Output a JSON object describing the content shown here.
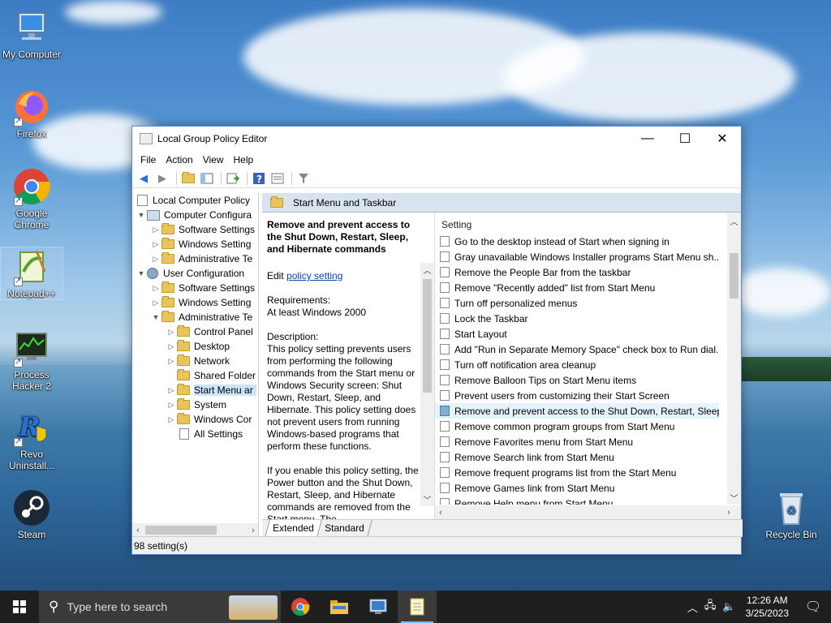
{
  "desktop": {
    "icons": [
      {
        "label": "My Computer"
      },
      {
        "label": "Firefox"
      },
      {
        "label": "Google Chrome"
      },
      {
        "label": "Notepad++"
      },
      {
        "label": "Process Hacker 2"
      },
      {
        "label": "Revo Uninstall..."
      },
      {
        "label": "Steam"
      },
      {
        "label": "Recycle Bin"
      }
    ]
  },
  "window": {
    "title": "Local Group Policy Editor",
    "controls": {
      "minimize": "—",
      "maximize": "☐",
      "close": "✕"
    },
    "menu": [
      "File",
      "Action",
      "View",
      "Help"
    ],
    "tree": [
      {
        "label": "Local Computer Policy"
      },
      {
        "label": "Computer Configura"
      },
      {
        "label": "Software Settings"
      },
      {
        "label": "Windows Setting"
      },
      {
        "label": "Administrative Te"
      },
      {
        "label": "User Configuration"
      },
      {
        "label": "Software Settings"
      },
      {
        "label": "Windows Setting"
      },
      {
        "label": "Administrative Te"
      },
      {
        "label": "Control Panel"
      },
      {
        "label": "Desktop"
      },
      {
        "label": "Network"
      },
      {
        "label": "Shared Folder"
      },
      {
        "label": "Start Menu ar"
      },
      {
        "label": "System"
      },
      {
        "label": "Windows Cor"
      },
      {
        "label": "All Settings"
      }
    ],
    "category": "Start Menu and Taskbar",
    "extended": {
      "title": "Remove and prevent access to the Shut Down, Restart, Sleep, and Hibernate commands",
      "edit_prefix": "Edit ",
      "edit_link": "policy setting",
      "requirements_label": "Requirements:",
      "requirements_value": "At least Windows 2000",
      "description_label": "Description:",
      "description": "This policy setting prevents users from performing the following commands from the Start menu or Windows Security screen: Shut Down, Restart, Sleep, and Hibernate. This policy setting does not prevent users from running Windows-based programs that perform these functions.",
      "paragraph2": "If you enable this policy setting, the Power button and the Shut Down, Restart, Sleep, and Hibernate commands are removed from the Start menu. The"
    },
    "list_header": "Setting",
    "settings": [
      "Go to the desktop instead of Start when signing in",
      "Gray unavailable Windows Installer programs Start Menu sh...",
      "Remove the People Bar from the taskbar",
      "Remove \"Recently added\" list from Start Menu",
      "Turn off personalized menus",
      "Lock the Taskbar",
      "Start Layout",
      "Add \"Run in Separate Memory Space\" check box to Run dial...",
      "Turn off notification area cleanup",
      "Remove Balloon Tips on Start Menu items",
      "Prevent users from customizing their Start Screen",
      "Remove and prevent access to the Shut Down, Restart, Sleep...",
      "Remove common program groups from Start Menu",
      "Remove Favorites menu from Start Menu",
      "Remove Search link from Start Menu",
      "Remove frequent programs list from the Start Menu",
      "Remove Games link from Start Menu",
      "Remove Help menu from Start Menu"
    ],
    "tabs": [
      "Extended",
      "Standard"
    ],
    "status": "98 setting(s)"
  },
  "taskbar": {
    "search_placeholder": "Type here to search",
    "time": "12:26 AM",
    "date": "3/25/2023"
  }
}
